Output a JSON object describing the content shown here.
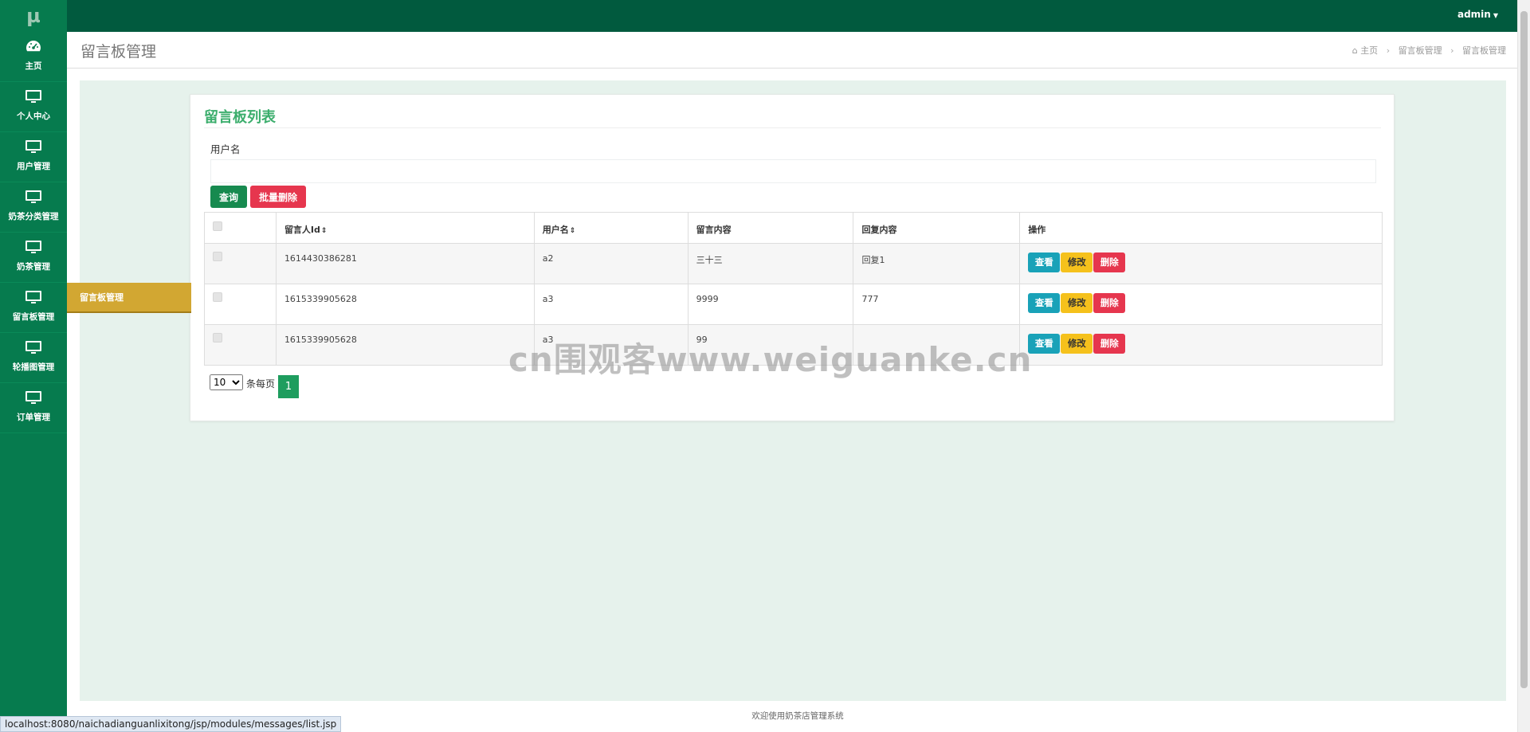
{
  "app": {
    "logo": "µ",
    "user": "admin"
  },
  "sidebar": {
    "items": [
      {
        "label": "主页",
        "icon": "dashboard-icon"
      },
      {
        "label": "个人中心",
        "icon": "monitor-icon"
      },
      {
        "label": "用户管理",
        "icon": "monitor-icon"
      },
      {
        "label": "奶茶分类管理",
        "icon": "monitor-icon"
      },
      {
        "label": "奶茶管理",
        "icon": "monitor-icon"
      },
      {
        "label": "留言板管理",
        "icon": "monitor-icon"
      },
      {
        "label": "轮播图管理",
        "icon": "monitor-icon"
      },
      {
        "label": "订单管理",
        "icon": "monitor-icon"
      }
    ],
    "flyout": "留言板管理"
  },
  "header": {
    "title": "留言板管理",
    "breadcrumb": {
      "home": "主页",
      "level1": "留言板管理",
      "level2": "留言板管理"
    }
  },
  "card": {
    "title": "留言板列表",
    "search": {
      "label": "用户名",
      "value": "",
      "placeholder": ""
    },
    "buttons": {
      "search": "查询",
      "batch_delete": "批量删除"
    }
  },
  "table": {
    "columns": [
      "留言人Id",
      "用户名",
      "留言内容",
      "回复内容",
      "操作"
    ],
    "rows": [
      {
        "id": "1614430386281",
        "username": "a2",
        "content": "三十三",
        "reply": "回复1"
      },
      {
        "id": "1615339905628",
        "username": "a3",
        "content": "9999",
        "reply": "777"
      },
      {
        "id": "1615339905628",
        "username": "a3",
        "content": "99",
        "reply": ""
      }
    ],
    "actions": {
      "view": "查看",
      "edit": "修改",
      "delete": "删除"
    }
  },
  "pagination": {
    "page_size": "10",
    "per_page_label": "条每页",
    "current_page": "1"
  },
  "watermark": "cn围观客www.weiguanke.cn",
  "footer": "欢迎使用奶茶店管理系统",
  "status_url": "localhost:8080/naichadianguanlixitong/jsp/modules/messages/list.jsp",
  "colors": {
    "topbar": "#015a3e",
    "sidebar": "#067b4e",
    "accent": "#3cae6d",
    "flyout": "#d2a732",
    "danger": "#e6364e",
    "info": "#19a2b8",
    "warning": "#f5c11c"
  }
}
